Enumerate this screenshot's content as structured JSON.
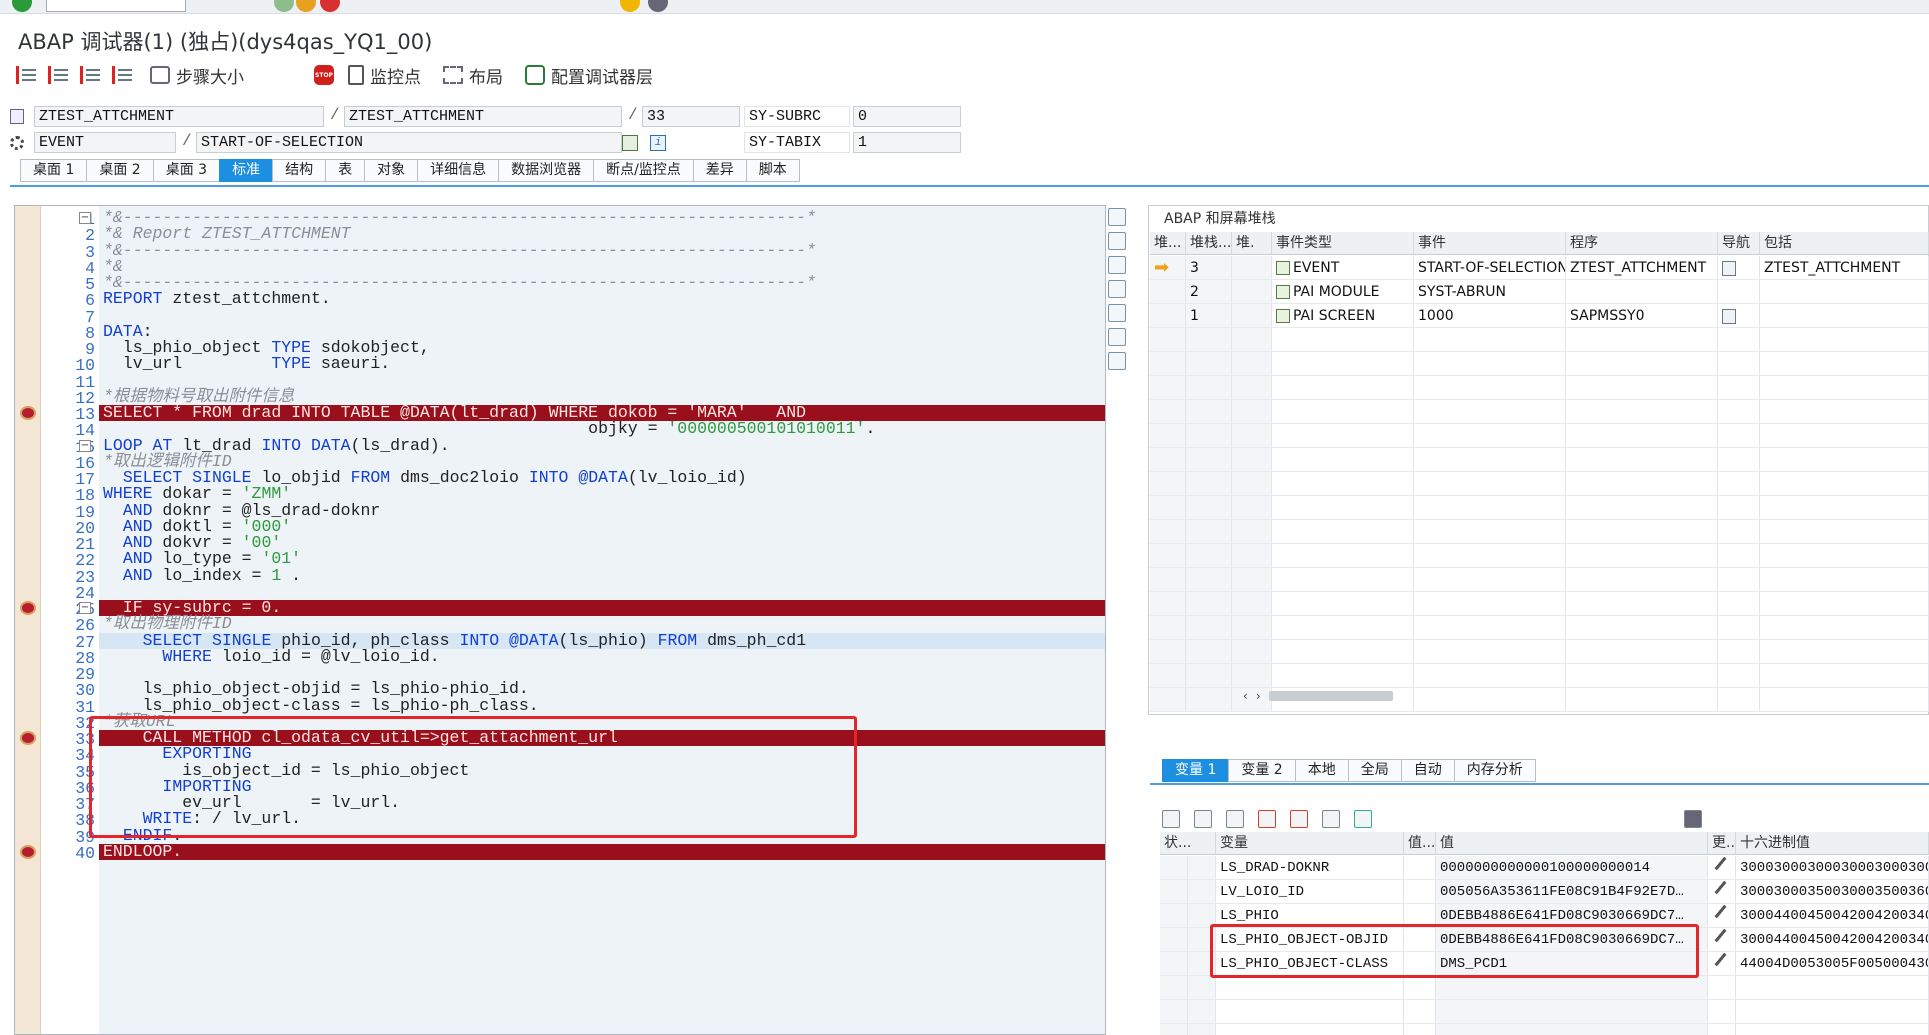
{
  "window": {
    "title": "ABAP 调试器(1)  (独占)(dys4qas_YQ1_00)"
  },
  "toolbar": {
    "step_size": "步骤大小",
    "watchpoint": "监控点",
    "layout": "布局",
    "configure_layers": "配置调试器层"
  },
  "fields": {
    "program": "ZTEST_ATTCHMENT",
    "include": "ZTEST_ATTCHMENT",
    "line": "33",
    "sysubrc_label": "SY-SUBRC",
    "sysubrc_value": "0",
    "event_type": "EVENT",
    "event_name": "START-OF-SELECTION",
    "sytabix_label": "SY-TABIX",
    "sytabix_value": "1"
  },
  "desk_tabs": [
    "桌面 1",
    "桌面 2",
    "桌面 3",
    "标准",
    "结构",
    "表",
    "对象",
    "详细信息",
    "数据浏览器",
    "断点/监控点",
    "差异",
    "脚本"
  ],
  "desk_tab_active": "标准",
  "code_lines": [
    {
      "n": "1",
      "t": "*&---------------------------------------------------------------------*",
      "c": "cmt",
      "fold": "−"
    },
    {
      "n": "2",
      "t": "*& Report ZTEST_ATTCHMENT",
      "c": "cmt"
    },
    {
      "n": "3",
      "t": "*&---------------------------------------------------------------------*",
      "c": "cmt"
    },
    {
      "n": "4",
      "t": "*&",
      "c": "cmt"
    },
    {
      "n": "5",
      "t": "*&---------------------------------------------------------------------*",
      "c": "cmt"
    },
    {
      "n": "6",
      "t": "REPORT ztest_attchment.",
      "c": "code"
    },
    {
      "n": "7",
      "t": "",
      "c": "code"
    },
    {
      "n": "8",
      "t": "DATA:",
      "c": "code"
    },
    {
      "n": "9",
      "t": "  ls_phio_object TYPE sdokobject,",
      "c": "code"
    },
    {
      "n": "10",
      "t": "  lv_url         TYPE saeuri.",
      "c": "code"
    },
    {
      "n": "11",
      "t": "",
      "c": "code"
    },
    {
      "n": "12",
      "t": "*根据物料号取出附件信息",
      "c": "cmt"
    },
    {
      "n": "13",
      "t": "SELECT * FROM drad INTO TABLE @DATA(lt_drad) WHERE dokob = 'MARA'   AND",
      "c": "hl",
      "bp": true
    },
    {
      "n": "14",
      "t": "                                                 objky = '000000500101010011'.",
      "c": "code"
    },
    {
      "n": "15",
      "t": "LOOP AT lt_drad INTO DATA(ls_drad).",
      "c": "code",
      "fold": "−"
    },
    {
      "n": "16",
      "t": "*取出逻辑附件ID",
      "c": "cmt"
    },
    {
      "n": "17",
      "t": "  SELECT SINGLE lo_objid FROM dms_doc2loio INTO @DATA(lv_loio_id)",
      "c": "code"
    },
    {
      "n": "18",
      "t": "WHERE dokar = 'ZMM'",
      "c": "code"
    },
    {
      "n": "19",
      "t": "  AND doknr = @ls_drad-doknr",
      "c": "code"
    },
    {
      "n": "20",
      "t": "  AND doktl = '000'",
      "c": "code"
    },
    {
      "n": "21",
      "t": "  AND dokvr = '00'",
      "c": "code"
    },
    {
      "n": "22",
      "t": "  AND lo_type = '01'",
      "c": "code"
    },
    {
      "n": "23",
      "t": "  AND lo_index = 1 .",
      "c": "code"
    },
    {
      "n": "24",
      "t": "",
      "c": "code"
    },
    {
      "n": "25",
      "t": "  IF sy-subrc = 0.",
      "c": "hl",
      "bp": true,
      "fold": "−"
    },
    {
      "n": "26",
      "t": "*取出物理附件ID",
      "c": "cmt"
    },
    {
      "n": "27",
      "t": "    SELECT SINGLE phio_id, ph_class INTO @DATA(ls_phio) FROM dms_ph_cd1",
      "c": "cur"
    },
    {
      "n": "28",
      "t": "      WHERE loio_id = @lv_loio_id.",
      "c": "code"
    },
    {
      "n": "29",
      "t": "",
      "c": "code"
    },
    {
      "n": "30",
      "t": "    ls_phio_object-objid = ls_phio-phio_id.",
      "c": "code"
    },
    {
      "n": "31",
      "t": "    ls_phio_object-class = ls_phio-ph_class.",
      "c": "code"
    },
    {
      "n": "32",
      "t": "*获取URL",
      "c": "cmt"
    },
    {
      "n": "33",
      "t": "    CALL METHOD cl_odata_cv_util=>get_attachment_url",
      "c": "hl",
      "bp": true
    },
    {
      "n": "34",
      "t": "      EXPORTING",
      "c": "code"
    },
    {
      "n": "35",
      "t": "        is_object_id = ls_phio_object",
      "c": "code"
    },
    {
      "n": "36",
      "t": "      IMPORTING",
      "c": "code"
    },
    {
      "n": "37",
      "t": "        ev_url       = lv_url.",
      "c": "code"
    },
    {
      "n": "38",
      "t": "    WRITE: / lv_url.",
      "c": "code"
    },
    {
      "n": "39",
      "t": "  ENDIF.",
      "c": "code"
    },
    {
      "n": "40",
      "t": "ENDLOOP.",
      "c": "hl",
      "bp": true
    }
  ],
  "stack": {
    "title": "ABAP 和屏幕堆栈",
    "headers": [
      "堆...",
      "堆栈...",
      "堆.",
      "事件类型",
      "事件",
      "程序",
      "导航",
      "包括"
    ],
    "rows": [
      {
        "level": "3",
        "type": "EVENT",
        "event": "START-OF-SELECTION",
        "program": "ZTEST_ATTCHMENT",
        "nav": true,
        "include": "ZTEST_ATTCHMENT",
        "current": true
      },
      {
        "level": "2",
        "type": "PAI MODULE",
        "event": "SYST-ABRUN",
        "program": "",
        "nav": false,
        "include": "",
        "current": false
      },
      {
        "level": "1",
        "type": "PAI SCREEN",
        "event": "1000",
        "program": "SAPMSSY0",
        "nav": true,
        "include": "",
        "current": false
      }
    ]
  },
  "var_tabs": [
    "变量 1",
    "变量 2",
    "本地",
    "全局",
    "自动",
    "内存分析"
  ],
  "var_tab_active": "变量 1",
  "variables": {
    "headers": [
      "状...",
      "变量",
      "值...",
      "值",
      "更...",
      "十六进制值"
    ],
    "rows": [
      {
        "name": "LS_DRAD-DOKNR",
        "value": "0000000000000100000000014",
        "hex": "30003000300030003000300030003000"
      },
      {
        "name": "LV_LOIO_ID",
        "value": "005056A353611FE08C91B4F92E7D…",
        "hex": "30003000350030003500360041003300"
      },
      {
        "name": "LS_PHIO",
        "value": "0DEBB4886E641FD08C9030669DC7…",
        "hex": "30004400450042004200340038003800"
      },
      {
        "name": "LS_PHIO_OBJECT-OBJID",
        "value": "0DEBB4886E641FD08C9030669DC7…",
        "hex": "30004400450042004200340038003800"
      },
      {
        "name": "LS_PHIO_OBJECT-CLASS",
        "value": "DMS_PCD1",
        "hex": "44004D0053005F005000430044003100"
      }
    ]
  }
}
